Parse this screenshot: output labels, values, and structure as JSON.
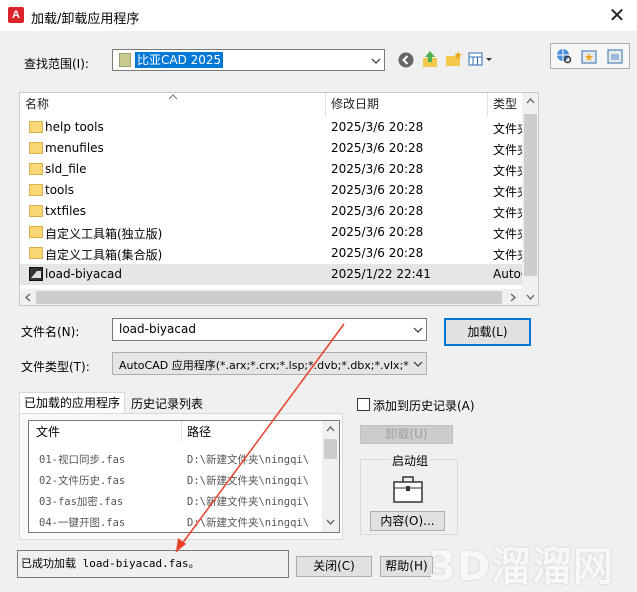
{
  "window": {
    "title": "加载/卸载应用程序"
  },
  "lookin": {
    "label": "查找范围(I):",
    "value": "比亚CAD 2025"
  },
  "list": {
    "columns": {
      "name": "名称",
      "date": "修改日期",
      "type": "类型"
    },
    "rows": [
      {
        "name": "help tools",
        "date": "2025/3/6 20:28",
        "type": "文件夹",
        "icon": "folder-icon"
      },
      {
        "name": "menufiles",
        "date": "2025/3/6 20:28",
        "type": "文件夹",
        "icon": "folder-icon"
      },
      {
        "name": "sld_file",
        "date": "2025/3/6 20:28",
        "type": "文件夹",
        "icon": "folder-icon"
      },
      {
        "name": "tools",
        "date": "2025/3/6 20:28",
        "type": "文件夹",
        "icon": "folder-icon"
      },
      {
        "name": "txtfiles",
        "date": "2025/3/6 20:28",
        "type": "文件夹",
        "icon": "folder-icon"
      },
      {
        "name": "自定义工具箱(独立版)",
        "date": "2025/3/6 20:28",
        "type": "文件夹",
        "icon": "folder-icon"
      },
      {
        "name": "自定义工具箱(集合版)",
        "date": "2025/3/6 20:28",
        "type": "文件夹",
        "icon": "folder-icon"
      },
      {
        "name": "load-biyacad",
        "date": "2025/1/22 22:41",
        "type": "AutoCAD",
        "icon": "autocad-file-icon",
        "selected": true
      }
    ]
  },
  "filename": {
    "label": "文件名(N):",
    "value": "load-biyacad"
  },
  "filetype": {
    "label": "文件类型(T):",
    "value": "AutoCAD 应用程序(*.arx;*.crx;*.lsp;*.dvb;*.dbx;*.vlx;*"
  },
  "buttons": {
    "load": "加载(L)",
    "unload": "卸载(U)",
    "contents": "内容(O)...",
    "close": "关闭(C)",
    "help": "帮助(H)"
  },
  "tabs": [
    {
      "label": "已加载的应用程序",
      "active": true
    },
    {
      "label": "历史记录列表",
      "active": false
    }
  ],
  "loaded": {
    "columns": {
      "file": "文件",
      "path": "路径"
    },
    "rows": [
      {
        "file": "01-视口同步.fas",
        "path": "D:\\新建文件夹\\ningqi\\"
      },
      {
        "file": "02-文件历史.fas",
        "path": "D:\\新建文件夹\\ningqi\\"
      },
      {
        "file": "03-fas加密.fas",
        "path": "D:\\新建文件夹\\ningqi\\"
      },
      {
        "file": "04-一键开图.fas",
        "path": "D:\\新建文件夹\\ningqi\\"
      }
    ]
  },
  "history_checkbox": {
    "label": "添加到历史记录(A)",
    "checked": false
  },
  "startup": {
    "label": "启动组"
  },
  "status": {
    "text": "已成功加载 load-biyacad.fas。"
  },
  "watermark": {
    "text": "3D溜溜网"
  },
  "colors": {
    "selection": "#0078d7",
    "arrow": "#e8402a",
    "appicon": "#d9242a"
  }
}
